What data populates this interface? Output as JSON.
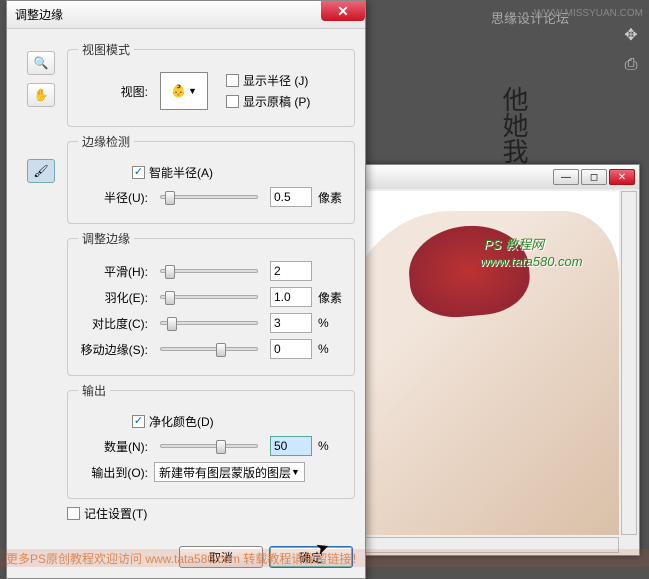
{
  "bg": {
    "forum": "思缘设计论坛",
    "missyuan": "WWW.MISSYUAN.COM",
    "calligraphy": "他她我帮你",
    "watermark_text": "PS 教程网",
    "watermark_url": "www.tata580.com",
    "footer": "更多PS原创教程欢迎访问 www.tata580.com  转载教程请保留链接！"
  },
  "dialog": {
    "title": "调整边缘",
    "view_mode": {
      "legend": "视图模式",
      "label": "视图:",
      "show_radius": "显示半径 (J)",
      "show_original": "显示原稿 (P)"
    },
    "edge_detect": {
      "legend": "边缘检测",
      "smart_radius": "智能半径(A)",
      "radius_label": "半径(U):",
      "radius_value": "0.5",
      "radius_unit": "像素"
    },
    "adjust": {
      "legend": "调整边缘",
      "smooth_label": "平滑(H):",
      "smooth_value": "2",
      "feather_label": "羽化(E):",
      "feather_value": "1.0",
      "feather_unit": "像素",
      "contrast_label": "对比度(C):",
      "contrast_value": "3",
      "contrast_unit": "%",
      "shift_label": "移动边缘(S):",
      "shift_value": "0",
      "shift_unit": "%"
    },
    "output": {
      "legend": "输出",
      "decontaminate": "净化颜色(D)",
      "amount_label": "数量(N):",
      "amount_value": "50",
      "amount_unit": "%",
      "to_label": "输出到(O):",
      "to_value": "新建带有图层蒙版的图层"
    },
    "remember": "记住设置(T)",
    "cancel": "取消",
    "ok": "确定"
  }
}
